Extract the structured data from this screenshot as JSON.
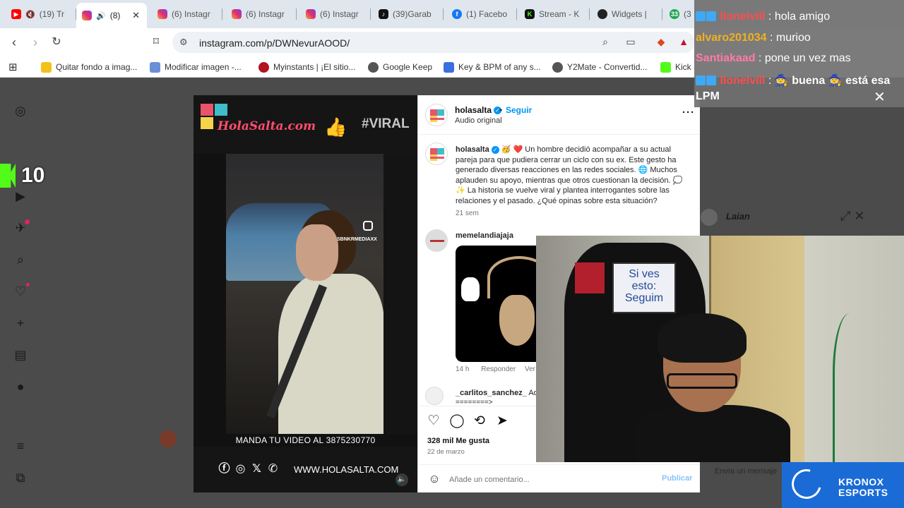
{
  "browser": {
    "tabs": [
      {
        "label": "(19) Tr",
        "fav": "yt",
        "icon": "youtube-icon"
      },
      {
        "label": "(8)",
        "fav": "ig",
        "icon": "instagram-icon",
        "active": true
      },
      {
        "label": "(6) Instagr",
        "fav": "ig",
        "icon": "instagram-icon"
      },
      {
        "label": "(6) Instagr",
        "fav": "ig",
        "icon": "instagram-icon"
      },
      {
        "label": "(6) Instagr",
        "fav": "ig",
        "icon": "instagram-icon"
      },
      {
        "label": "(39)Garab",
        "fav": "tt",
        "icon": "tiktok-icon"
      },
      {
        "label": "(1) Facebo",
        "fav": "fb",
        "icon": "facebook-icon"
      },
      {
        "label": "Stream - K",
        "fav": "kk",
        "icon": "kick-icon"
      },
      {
        "label": "Widgets |",
        "fav": "wg",
        "icon": "widgets-icon"
      },
      {
        "label": "(3",
        "fav": "num",
        "icon": "counter-icon"
      }
    ],
    "url": "instagram.com/p/DWNevurAOOD/",
    "bookmarks": [
      {
        "label": "Quitar fondo a imag...",
        "color": "#f2c21b"
      },
      {
        "label": "Modificar imagen -...",
        "color": "#6a8fd6"
      },
      {
        "label": "Myinstants | ¡El sitio...",
        "color": "#b3121e"
      },
      {
        "label": "Google Keep",
        "color": "#555555"
      },
      {
        "label": "Key & BPM of any s...",
        "color": "#3a6fe0"
      },
      {
        "label": "Y2Mate - Convertid...",
        "color": "#555555"
      },
      {
        "label": "Kick",
        "color": "#53fc18"
      }
    ]
  },
  "stream": {
    "kick_count": "10",
    "chat": [
      {
        "user": "llonelvill",
        "msg": "hola amigo",
        "color": "#ff4d4d"
      },
      {
        "user": "alvaro201034",
        "msg": "murioo",
        "color": "#f0b020"
      },
      {
        "user": "Santiakaad",
        "msg": "pone un vez mas",
        "color": "#ff7aa8"
      },
      {
        "user": "llonelvill",
        "msg": "buena",
        "msg2": "está esa",
        "color": "#ff4d4d"
      },
      {
        "user": "",
        "msg": "LPM",
        "color": "#ffffff"
      }
    ],
    "caller_name": "Laian",
    "sign_text": [
      "Si ves",
      "esto:",
      "Seguim"
    ],
    "kronox_line1": "KRONOX",
    "kronox_line2": "ESPORTS",
    "dim_message_placeholder": "Envía un mensaje"
  },
  "video": {
    "brand": "HolaSalta.com",
    "hashtag": "#VIRAL",
    "watermark": "SBNKRMEDIAXX",
    "cta": "MANDA TU VIDEO AL 3875230770",
    "website": "WWW.HOLASALTA.COM"
  },
  "post": {
    "username": "holasalta",
    "follow": "Seguir",
    "audio": "Audio original",
    "caption": "Un hombre decidió acompañar a su actual pareja para que pudiera cerrar un ciclo con su ex. Este gesto ha generado diversas reacciones en las redes sociales. 🌐 Muchos aplauden su apoyo, mientras que otros cuestionan la decisión. 💭 ✨ La historia se vuelve viral y plantea interrogantes sobre las relaciones y el pasado. ¿Qué opinas sobre esta situación?",
    "caption_time": "21 sem",
    "comment1_user": "memelandiajaja",
    "comment1_meta_time": "14 h",
    "comment1_reply": "Responder",
    "comment1_translate": "Ver tra",
    "comment2_user": "_carlitos_sanchez_",
    "comment2_text": "Aqu",
    "comment2_more": "========>",
    "likes": "328 mil Me gusta",
    "date": "22 de marzo",
    "comment_placeholder": "Añade un comentario...",
    "publish": "Publicar"
  },
  "colors": {
    "ig_blue": "#0095f6",
    "kick_green": "#53fc18",
    "kronox_blue": "#1a6bd6"
  }
}
